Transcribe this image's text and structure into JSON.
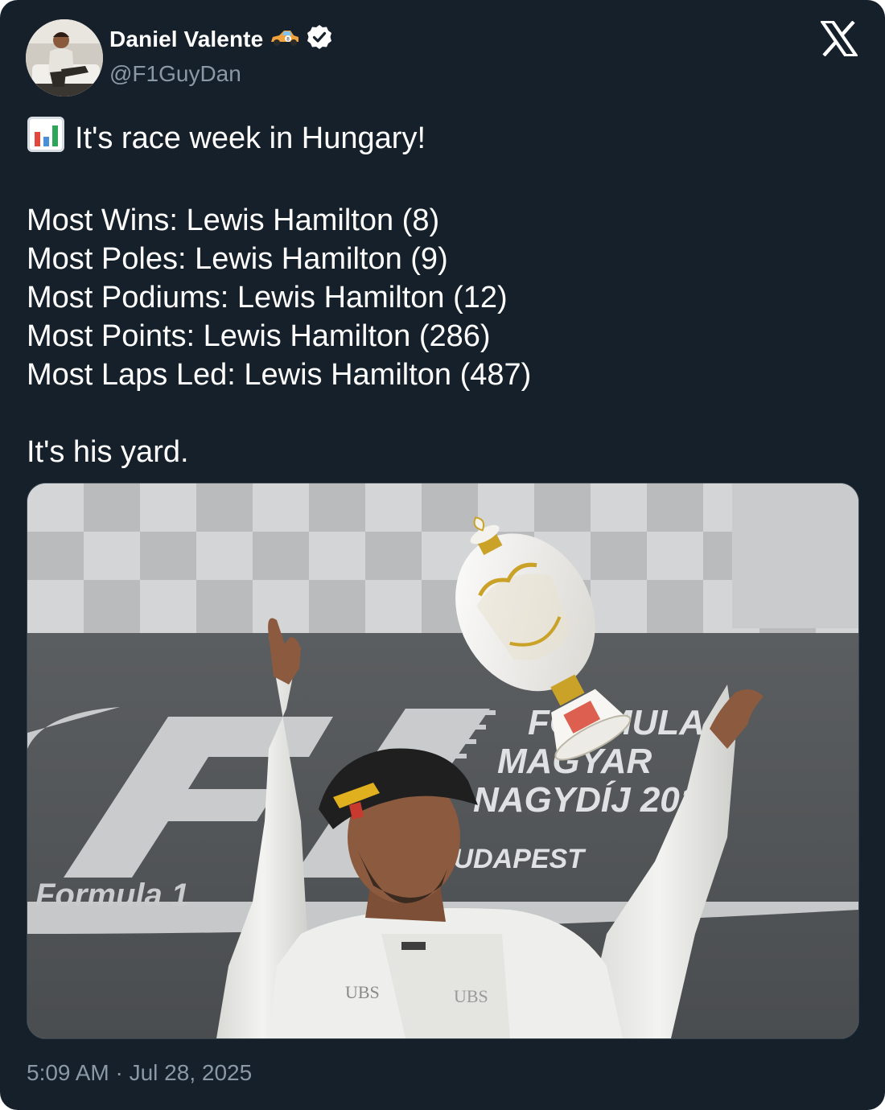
{
  "author": {
    "display_name": "Daniel Valente",
    "name_emoji": "race-car-emoji",
    "verified_badge": "verified-badge-icon",
    "handle": "@F1GuyDan",
    "avatar": "avatar"
  },
  "platform": {
    "logo": "x-logo-icon"
  },
  "tweet": {
    "lead_emoji": "bar-chart-emoji",
    "headline": "It's race week in Hungary!",
    "stats": [
      "Most Wins: Lewis Hamilton (8)",
      "Most Poles: Lewis Hamilton (9)",
      "Most Podiums: Lewis Hamilton (12)",
      "Most Points: Lewis Hamilton (286)",
      "Most Laps Led: Lewis Hamilton (487)"
    ],
    "closing": "It's his yard."
  },
  "media": {
    "banner_title_line1": "FORMULA 1",
    "banner_title_line2": "MAGYAR",
    "banner_title_line3": "NAGYDÍJ 2016",
    "banner_city": "BUDAPEST",
    "banner_brand": "Formula 1"
  },
  "timestamp": "5:09 AM · Jul 28, 2025",
  "colors": {
    "background": "#15202b",
    "text": "#ffffff",
    "secondary_text": "#8b98a5",
    "verified": "#ffffff"
  }
}
